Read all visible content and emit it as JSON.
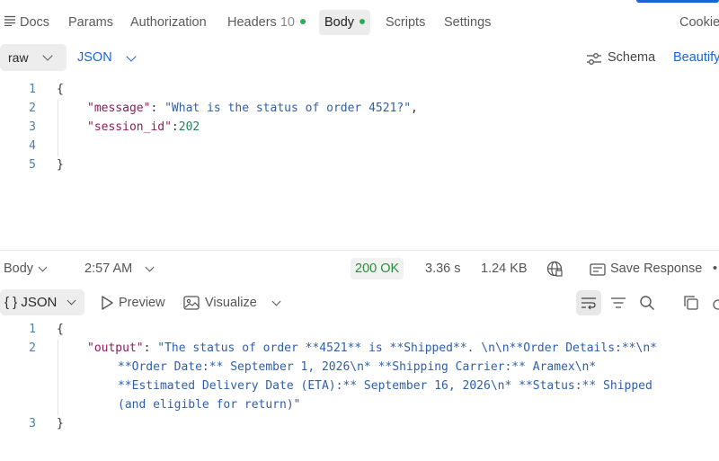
{
  "tabs": {
    "docs": "Docs",
    "params": "Params",
    "authorization": "Authorization",
    "headers": "Headers",
    "headers_count": "10",
    "body": "Body",
    "scripts": "Scripts",
    "settings": "Settings",
    "cookies": "Cookies"
  },
  "request_toolbar": {
    "body_type": "raw",
    "language": "JSON",
    "schema": "Schema",
    "beautify": "Beautify"
  },
  "request_body": {
    "line_numbers": [
      "1",
      "2",
      "3",
      "4",
      "5"
    ],
    "open_brace": "{",
    "close_brace": "}",
    "message_key": "\"message\"",
    "message_value": "\"What is the status of order 4521?\"",
    "session_key": "\"session_id\"",
    "session_value": "202"
  },
  "response_bar": {
    "section": "Body",
    "time": "2:57 AM",
    "status": "200 OK",
    "duration": "3.36 s",
    "size": "1.24 KB",
    "save_response": "Save Response"
  },
  "response_toolbar": {
    "format": "{ } JSON",
    "preview": "Preview",
    "visualize": "Visualize"
  },
  "response_body": {
    "line_numbers": [
      "1",
      "2",
      "3"
    ],
    "open_brace": "{",
    "close_brace": "}",
    "output_key": "\"output\"",
    "output_line1": "\"The status of order **4521** is **Shipped**. \\n\\n**Order Details:**\\n*",
    "output_line2": "**Order Date:** September 1, 2026\\n* **Shipping Carrier:** Aramex\\n*",
    "output_line3": "**Estimated Delivery Date (ETA):** September 16, 2026\\n* **Status:** Shipped",
    "output_line4": "(and eligible for return)\""
  },
  "colors": {
    "accent_blue": "#1c64d6",
    "status_green": "#2a8c3a",
    "json_key": "#8c1d5a",
    "json_string": "#2f5fa8",
    "json_number": "#2a7e5a"
  },
  "icons": [
    "docs-icon",
    "chevron-down-icon",
    "schema-icon",
    "globe-icon",
    "save-icon",
    "play-icon",
    "image-icon",
    "wrap-icon",
    "filter-icon",
    "search-icon",
    "copy-icon"
  ]
}
